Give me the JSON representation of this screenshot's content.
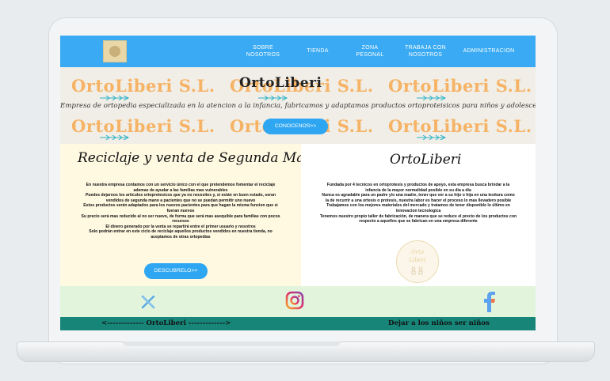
{
  "nav": {
    "items": [
      {
        "label": "SOBRE\nNOSOTROS"
      },
      {
        "label": "TIENDA"
      },
      {
        "label": "ZONA\nPESONAL"
      },
      {
        "label": "TRABAJA CON\nNOSOTROS"
      },
      {
        "label": "ADMINISTRACION"
      }
    ]
  },
  "hero": {
    "watermark": "OrtoLiberi S.L.",
    "title": "OrtoLiberi",
    "subtitle": "Empresa de ortopedia especializada en la atencion a la infancia, fabricamos y adaptamos productos ortoproteisicos para niños y adolescentes",
    "button": "CONOCENOS>>"
  },
  "left": {
    "title": "Reciclaje y venta de Segunda Mano",
    "text": [
      "En nuestra empresa contamos con un servicio único con el que pretendemos fomentar el reciclaje",
      "ademas de ayudar a las familias mas vulnerables",
      "Puedes dejarnos los articulos ortoprotesicos que ya no necesites y, si están en buen estado, seran",
      "vendidos de segunda mano a pacientes que no se puedan permitir uno nuevo",
      "Estos productos serán adaptados para los nuevos pacientes para que hagan la misma funcion que si",
      "fueran nuevos",
      "Su precio será mas reducido al no ser nuevo, de forma que será mas asequible para familias con pocos",
      "recursos",
      "El dinero generado por la venta se repartirá entre el primer usuario y nosotros",
      "Solo podrán entrar en este ciclo de reciclaje aquellos productos vendidos en nuestra tienda, no",
      "aceptamos de otras ortopedias"
    ],
    "button": "DESCUBRELO>>"
  },
  "right": {
    "title": "OrtoLiberi",
    "text": [
      "Fundada por 4 tecnicos en ortoprotesis y productos de apoyo, esta empresa busca brindar a la",
      "infancia de la mayor normalidad posible en su dia a dia",
      "Nunca es agradable para un padre y/o una madre, tener que ver a su hijo o hija en una tesitura como",
      "la de recurrir a una ortesis o protesis, nuestra labor es hacer el proceso lo mas llevadero posible",
      "Trabajamos con los mejores materiales del mercado y tratamos de tener disponible lo último en",
      "innovacion tecnologica",
      "Tenemos nuestro propio taller de fabricación, de manera que se reduce el precio de los productos con",
      "respecto a aquellos que se fabrican en una empresa diferente"
    ],
    "stamp_line1": "Orto",
    "stamp_line2": "Liberi"
  },
  "footer": {
    "left": "<------------- OrtoLiberi ------------->",
    "right": "Dejar a los niños ser niños"
  },
  "colors": {
    "nav": "#39aaf3",
    "watermark": "#f6b366",
    "footer": "#178679",
    "social_bg": "#e2f5dc",
    "left_bg": "#fff9e2"
  }
}
